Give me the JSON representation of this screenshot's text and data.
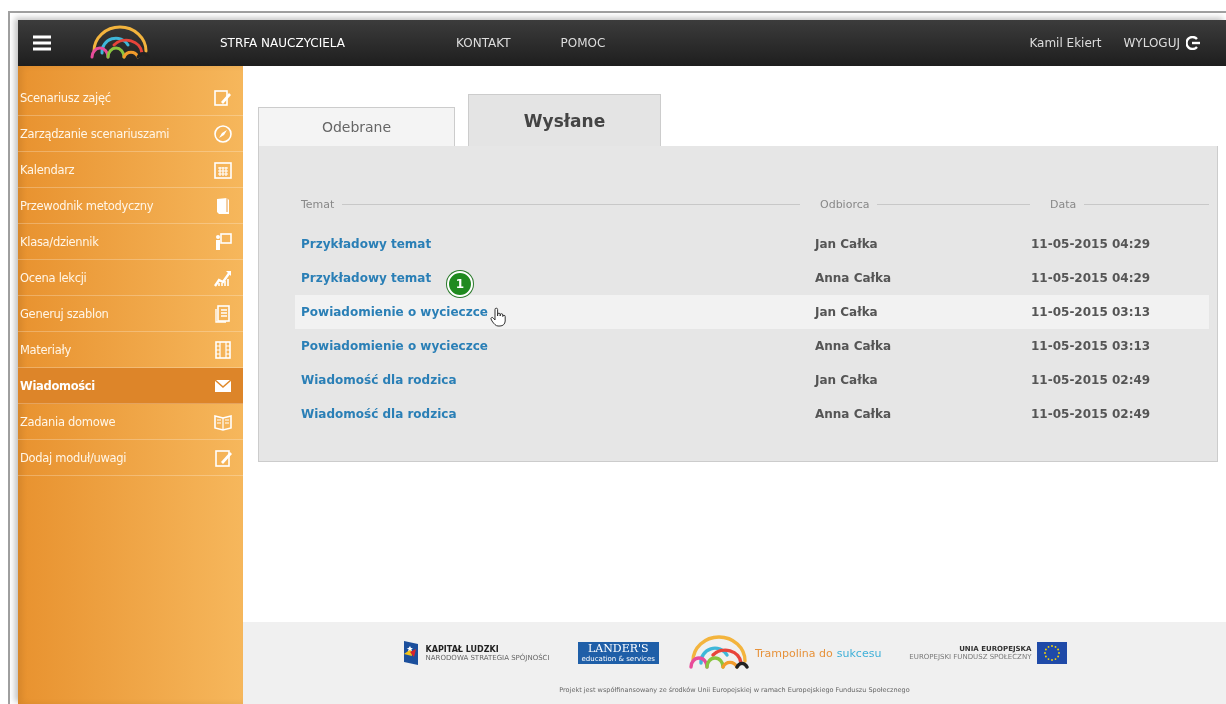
{
  "header": {
    "nav": [
      "STRFA NAUCZYCIELA",
      "KONTAKT",
      "POMOC"
    ],
    "user": "Kamil Ekiert",
    "logout": "WYLOGUJ"
  },
  "sidebar": {
    "items": [
      {
        "label": "Scenariusz zajęć",
        "selected": false
      },
      {
        "label": "Zarządzanie scenariuszami",
        "selected": false
      },
      {
        "label": "Kalendarz",
        "selected": false
      },
      {
        "label": "Przewodnik metodyczny",
        "selected": false
      },
      {
        "label": "Klasa/dziennik",
        "selected": false
      },
      {
        "label": "Ocena lekcji",
        "selected": false
      },
      {
        "label": "Generuj szablon",
        "selected": false
      },
      {
        "label": "Materiały",
        "selected": false
      },
      {
        "label": "Wiadomości",
        "selected": true
      },
      {
        "label": "Zadania domowe",
        "selected": false
      },
      {
        "label": "Dodaj moduł/uwagi",
        "selected": false
      }
    ]
  },
  "tabs": [
    {
      "label": "Odebrane",
      "selected": false
    },
    {
      "label": "Wysłane",
      "selected": true
    }
  ],
  "table": {
    "columns": [
      "Temat",
      "Odbiorca",
      "Data"
    ],
    "rows": [
      {
        "subject": "Przykładowy temat",
        "recipient": "Jan Całka",
        "date": "11-05-2015 04:29",
        "selected": false
      },
      {
        "subject": "Przykładowy temat",
        "recipient": "Anna Całka",
        "date": "11-05-2015 04:29",
        "selected": false
      },
      {
        "subject": "Powiadomienie o wycieczce",
        "recipient": "Jan Całka",
        "date": "11-05-2015 03:13",
        "selected": true,
        "annotation": "1"
      },
      {
        "subject": "Powiadomienie o wycieczce",
        "recipient": "Anna Całka",
        "date": "11-05-2015 03:13",
        "selected": false
      },
      {
        "subject": "Wiadomość dla rodzica",
        "recipient": "Jan Całka",
        "date": "11-05-2015 02:49",
        "selected": false
      },
      {
        "subject": "Wiadomość dla rodzica",
        "recipient": "Anna Całka",
        "date": "11-05-2015 02:49",
        "selected": false
      }
    ]
  },
  "footer": {
    "kapital": {
      "title": "KAPITAŁ LUDZKI",
      "subtitle": "NARODOWA STRATEGIA SPÓJNOŚCI"
    },
    "landers": {
      "title": "LANDER'S",
      "subtitle": "education & services"
    },
    "trampolina": [
      "Trampolina do",
      "sukcesu"
    ],
    "eu": {
      "title": "UNIA EUROPEJSKA",
      "subtitle": "EUROPEJSKI FUNDUSZ SPOŁECZNY"
    },
    "note": "Projekt jest współfinansowany ze środków Unii Europejskiej w ramach Europejskiego Funduszu Społecznego"
  }
}
